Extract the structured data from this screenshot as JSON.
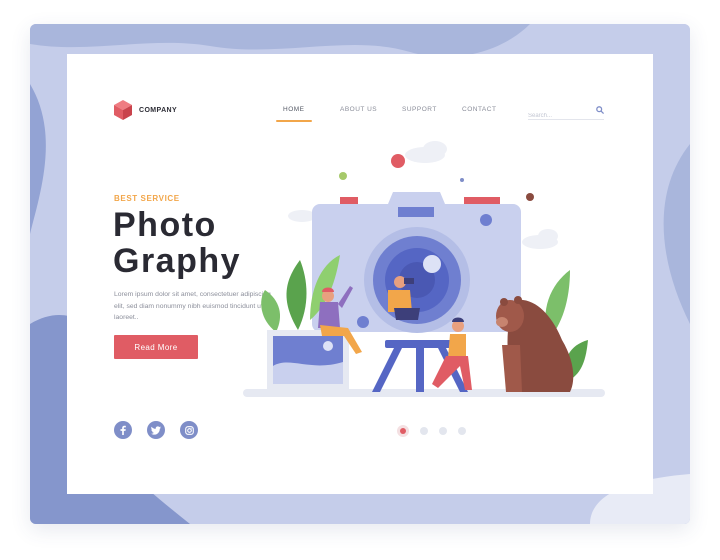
{
  "brand": {
    "name": "COMPANY",
    "logo_icon": "cube-icon",
    "logo_color": "#e05c64"
  },
  "nav": {
    "items": [
      {
        "label": "HOME",
        "active": true
      },
      {
        "label": "ABOUT US",
        "active": false
      },
      {
        "label": "SUPPORT",
        "active": false
      },
      {
        "label": "CONTACT",
        "active": false
      }
    ],
    "active_color": "#f2a64a"
  },
  "search": {
    "placeholder": "Search...",
    "icon": "search-icon"
  },
  "hero": {
    "eyebrow": "BEST SERVICE",
    "title_line1": "Photo",
    "title_line2": "Graphy",
    "description": "Lorem ipsum dolor sit amet, consectetuer adipiscing elit, sed diam nonummy nibh euismod tincidunt ut laoreet..",
    "button_label": "Read More"
  },
  "socials": [
    {
      "icon": "facebook-icon",
      "glyph": "f"
    },
    {
      "icon": "twitter-icon",
      "glyph": "t"
    },
    {
      "icon": "instagram-icon",
      "glyph": "◎"
    }
  ],
  "slider": {
    "count": 4,
    "active_index": 0
  },
  "colors": {
    "accent": "#f2a64a",
    "primary": "#e05c64",
    "illustration": "#7f8ec8",
    "background": "#c5cdea"
  }
}
